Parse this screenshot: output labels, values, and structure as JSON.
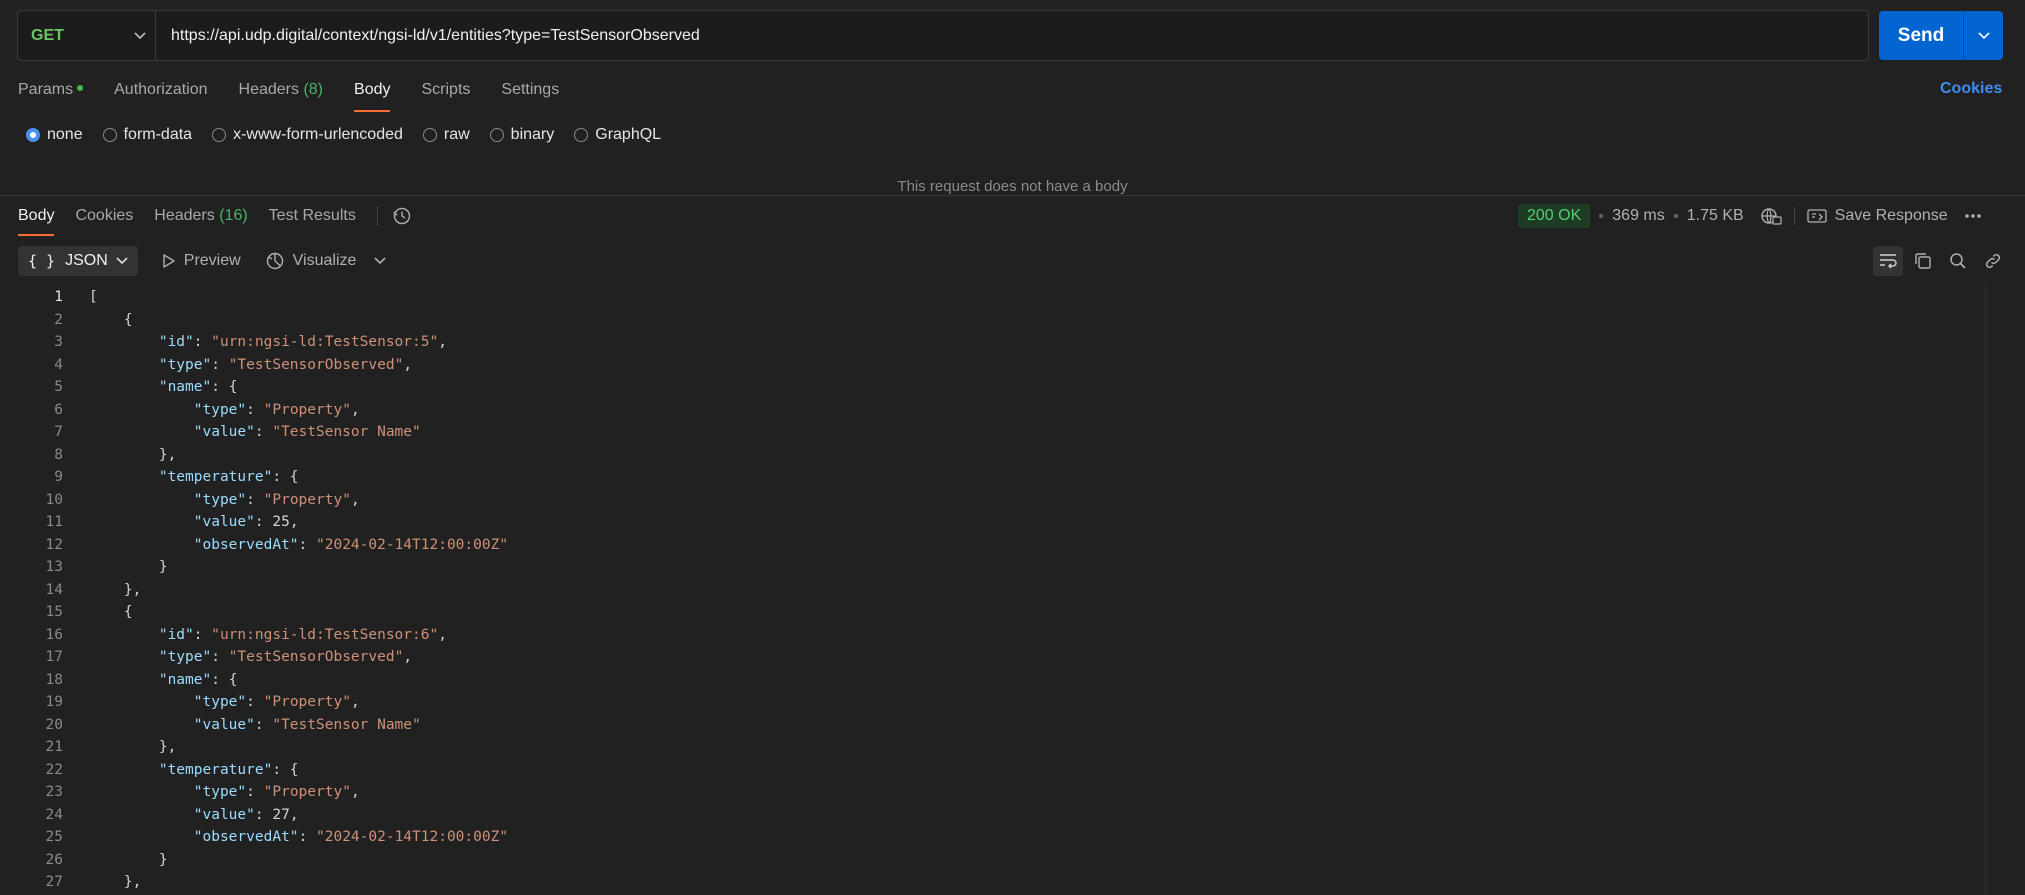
{
  "request": {
    "method": "GET",
    "url": "https://api.udp.digital/context/ngsi-ld/v1/entities?type=TestSensorObserved",
    "send_label": "Send"
  },
  "req_tabs": {
    "params": "Params",
    "authorization": "Authorization",
    "headers": "Headers",
    "headers_count": "(8)",
    "body": "Body",
    "scripts": "Scripts",
    "settings": "Settings",
    "cookies": "Cookies"
  },
  "body_types": {
    "none": "none",
    "form_data": "form-data",
    "urlencoded": "x-www-form-urlencoded",
    "raw": "raw",
    "binary": "binary",
    "graphql": "GraphQL"
  },
  "no_body_message": "This request does not have a body",
  "resp_tabs": {
    "body": "Body",
    "cookies": "Cookies",
    "headers": "Headers",
    "headers_count": "(16)",
    "test_results": "Test Results"
  },
  "response_meta": {
    "status": "200 OK",
    "time": "369 ms",
    "size": "1.75 KB",
    "save": "Save Response"
  },
  "toolbar": {
    "format": "JSON",
    "preview": "Preview",
    "visualize": "Visualize"
  },
  "icons": [
    "chevron-down-icon",
    "history-icon",
    "globe-icon",
    "save-icon",
    "more-icon",
    "wrap-icon",
    "copy-icon",
    "search-icon",
    "link-icon",
    "play-icon",
    "visualize-icon"
  ],
  "colors": {
    "accent": "#ff6c37",
    "send": "#0265d2",
    "status_ok": "#4fd173",
    "method_get": "#6bc563"
  },
  "code_lines": [
    [
      {
        "t": "p",
        "v": "["
      }
    ],
    [
      {
        "t": "p",
        "v": "    {"
      }
    ],
    [
      {
        "t": "p",
        "v": "        "
      },
      {
        "t": "k",
        "v": "\"id\""
      },
      {
        "t": "p",
        "v": ": "
      },
      {
        "t": "s",
        "v": "\"urn:ngsi-ld:TestSensor:5\""
      },
      {
        "t": "p",
        "v": ","
      }
    ],
    [
      {
        "t": "p",
        "v": "        "
      },
      {
        "t": "k",
        "v": "\"type\""
      },
      {
        "t": "p",
        "v": ": "
      },
      {
        "t": "s",
        "v": "\"TestSensorObserved\""
      },
      {
        "t": "p",
        "v": ","
      }
    ],
    [
      {
        "t": "p",
        "v": "        "
      },
      {
        "t": "k",
        "v": "\"name\""
      },
      {
        "t": "p",
        "v": ": {"
      }
    ],
    [
      {
        "t": "p",
        "v": "            "
      },
      {
        "t": "k",
        "v": "\"type\""
      },
      {
        "t": "p",
        "v": ": "
      },
      {
        "t": "s",
        "v": "\"Property\""
      },
      {
        "t": "p",
        "v": ","
      }
    ],
    [
      {
        "t": "p",
        "v": "            "
      },
      {
        "t": "k",
        "v": "\"value\""
      },
      {
        "t": "p",
        "v": ": "
      },
      {
        "t": "s",
        "v": "\"TestSensor Name\""
      }
    ],
    [
      {
        "t": "p",
        "v": "        },"
      }
    ],
    [
      {
        "t": "p",
        "v": "        "
      },
      {
        "t": "k",
        "v": "\"temperature\""
      },
      {
        "t": "p",
        "v": ": {"
      }
    ],
    [
      {
        "t": "p",
        "v": "            "
      },
      {
        "t": "k",
        "v": "\"type\""
      },
      {
        "t": "p",
        "v": ": "
      },
      {
        "t": "s",
        "v": "\"Property\""
      },
      {
        "t": "p",
        "v": ","
      }
    ],
    [
      {
        "t": "p",
        "v": "            "
      },
      {
        "t": "k",
        "v": "\"value\""
      },
      {
        "t": "p",
        "v": ": "
      },
      {
        "t": "n",
        "v": "25"
      },
      {
        "t": "p",
        "v": ","
      }
    ],
    [
      {
        "t": "p",
        "v": "            "
      },
      {
        "t": "k",
        "v": "\"observedAt\""
      },
      {
        "t": "p",
        "v": ": "
      },
      {
        "t": "s",
        "v": "\"2024-02-14T12:00:00Z\""
      }
    ],
    [
      {
        "t": "p",
        "v": "        }"
      }
    ],
    [
      {
        "t": "p",
        "v": "    },"
      }
    ],
    [
      {
        "t": "p",
        "v": "    {"
      }
    ],
    [
      {
        "t": "p",
        "v": "        "
      },
      {
        "t": "k",
        "v": "\"id\""
      },
      {
        "t": "p",
        "v": ": "
      },
      {
        "t": "s",
        "v": "\"urn:ngsi-ld:TestSensor:6\""
      },
      {
        "t": "p",
        "v": ","
      }
    ],
    [
      {
        "t": "p",
        "v": "        "
      },
      {
        "t": "k",
        "v": "\"type\""
      },
      {
        "t": "p",
        "v": ": "
      },
      {
        "t": "s",
        "v": "\"TestSensorObserved\""
      },
      {
        "t": "p",
        "v": ","
      }
    ],
    [
      {
        "t": "p",
        "v": "        "
      },
      {
        "t": "k",
        "v": "\"name\""
      },
      {
        "t": "p",
        "v": ": {"
      }
    ],
    [
      {
        "t": "p",
        "v": "            "
      },
      {
        "t": "k",
        "v": "\"type\""
      },
      {
        "t": "p",
        "v": ": "
      },
      {
        "t": "s",
        "v": "\"Property\""
      },
      {
        "t": "p",
        "v": ","
      }
    ],
    [
      {
        "t": "p",
        "v": "            "
      },
      {
        "t": "k",
        "v": "\"value\""
      },
      {
        "t": "p",
        "v": ": "
      },
      {
        "t": "s",
        "v": "\"TestSensor Name\""
      }
    ],
    [
      {
        "t": "p",
        "v": "        },"
      }
    ],
    [
      {
        "t": "p",
        "v": "        "
      },
      {
        "t": "k",
        "v": "\"temperature\""
      },
      {
        "t": "p",
        "v": ": {"
      }
    ],
    [
      {
        "t": "p",
        "v": "            "
      },
      {
        "t": "k",
        "v": "\"type\""
      },
      {
        "t": "p",
        "v": ": "
      },
      {
        "t": "s",
        "v": "\"Property\""
      },
      {
        "t": "p",
        "v": ","
      }
    ],
    [
      {
        "t": "p",
        "v": "            "
      },
      {
        "t": "k",
        "v": "\"value\""
      },
      {
        "t": "p",
        "v": ": "
      },
      {
        "t": "n",
        "v": "27"
      },
      {
        "t": "p",
        "v": ","
      }
    ],
    [
      {
        "t": "p",
        "v": "            "
      },
      {
        "t": "k",
        "v": "\"observedAt\""
      },
      {
        "t": "p",
        "v": ": "
      },
      {
        "t": "s",
        "v": "\"2024-02-14T12:00:00Z\""
      }
    ],
    [
      {
        "t": "p",
        "v": "        }"
      }
    ],
    [
      {
        "t": "p",
        "v": "    },"
      }
    ]
  ]
}
